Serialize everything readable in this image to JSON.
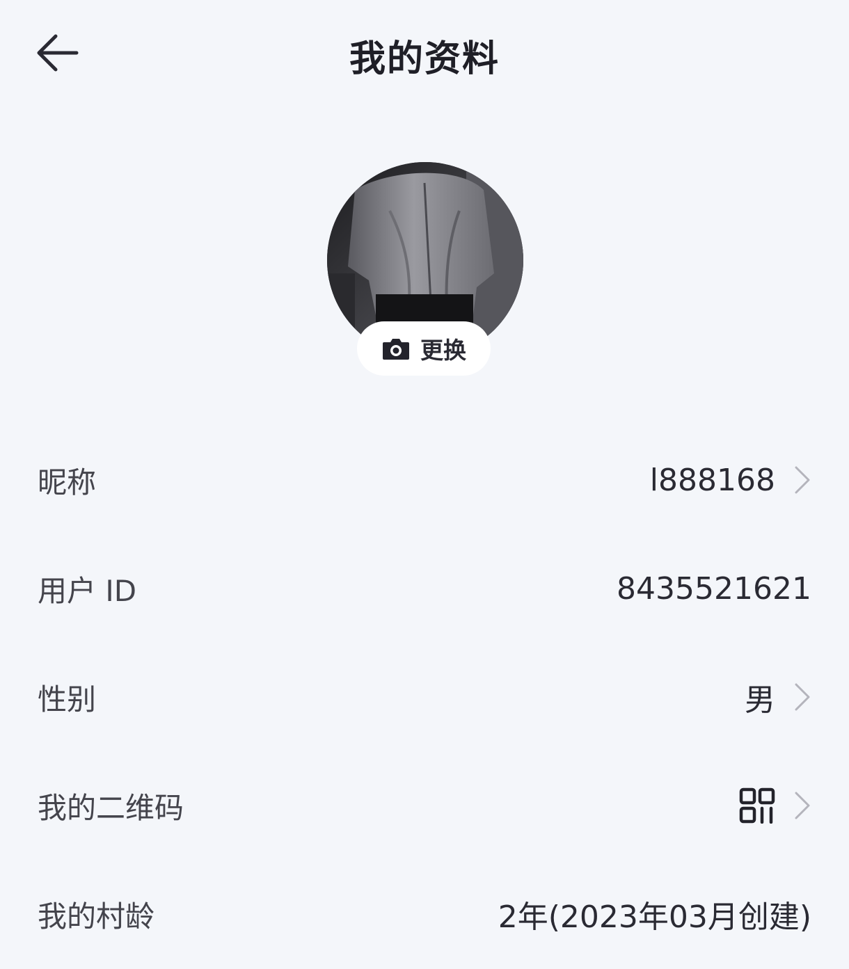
{
  "header": {
    "title": "我的资料",
    "back_icon": "arrow-left-icon"
  },
  "avatar": {
    "change_label": "更换",
    "change_icon": "camera-icon"
  },
  "rows": [
    {
      "label": "昵称",
      "value": "l888168",
      "has_chevron": true
    },
    {
      "label": "用户 ID",
      "value": "8435521621",
      "has_chevron": false
    },
    {
      "label": "性别",
      "value": "男",
      "has_chevron": true
    },
    {
      "label": "我的二维码",
      "value_icon": "qr-code-icon",
      "has_chevron": true
    },
    {
      "label": "我的村龄",
      "value": "2年(2023年03月创建)",
      "has_chevron": false
    }
  ],
  "colors": {
    "background": "#f4f6fa",
    "text_primary": "#2a2a33",
    "text_label": "#44444c",
    "chevron": "#b4b4bc"
  }
}
